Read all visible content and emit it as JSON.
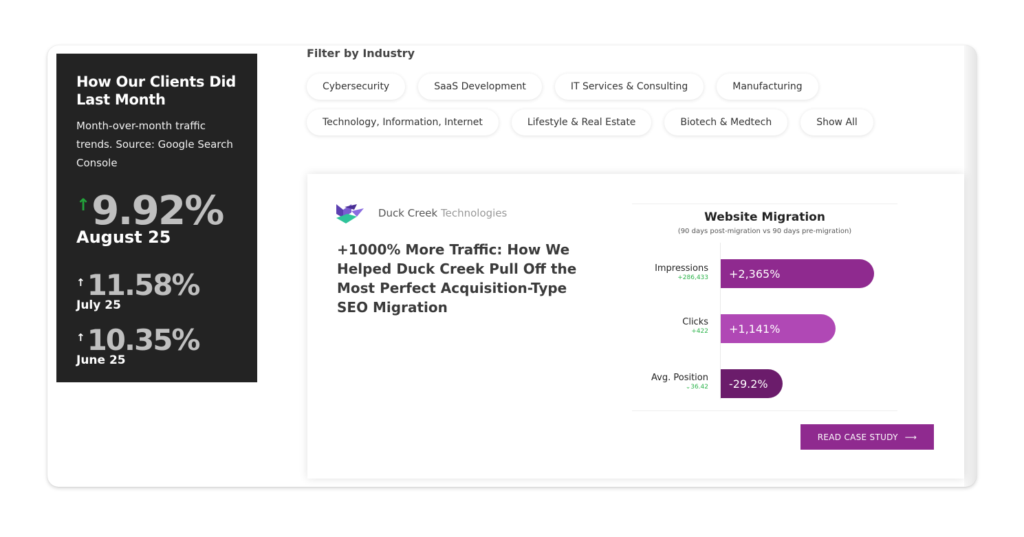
{
  "stats": {
    "title": "How Our Clients Did Last Month",
    "description": "Month-over-month traffic trends. Source: Google Search Console",
    "items": [
      {
        "value": "9.92%",
        "month": "August 25"
      },
      {
        "value": "11.58%",
        "month": "July 25"
      },
      {
        "value": "10.35%",
        "month": "June 25"
      }
    ],
    "colors": {
      "main_arrow": "#22a33a",
      "panel": "#232323"
    }
  },
  "filter": {
    "title": "Filter by Industry",
    "chips_row1": [
      "Cybersecurity",
      "SaaS Development",
      "IT Services & Consulting",
      "Manufacturing"
    ],
    "chips_row2": [
      "Technology, Information, Internet",
      "Lifestyle & Real Estate",
      "Biotech & Medtech",
      "Show All"
    ]
  },
  "case": {
    "brand_part1": "Duck Creek",
    "brand_part2": "Technologies",
    "headline": "+1000% More Traffic: How We Helped Duck Creek Pull Off the Most Perfect Acquisition-Type SEO Migration",
    "cta": "READ CASE STUDY",
    "cta_arrow": "⟶"
  },
  "chart_data": {
    "type": "bar",
    "title": "Website Migration",
    "subtitle": "(90 days post-migration vs 90 days pre-migration)",
    "categories": [
      "Impressions",
      "Clicks",
      "Avg. Position"
    ],
    "values": [
      2365,
      1141,
      -29.2
    ],
    "value_labels": [
      "+2,365%",
      "+1,141%",
      "-29.2%"
    ],
    "deltas": [
      "+286,433",
      "+422",
      "⌄36.42"
    ],
    "colors": [
      "#8f2a8f",
      "#b048b5",
      "#6b1c6b"
    ]
  }
}
